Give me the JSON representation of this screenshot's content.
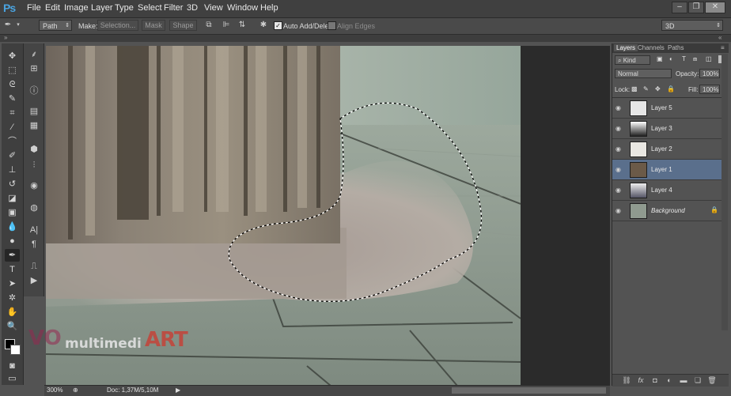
{
  "app": {
    "logo": "Ps"
  },
  "menubar": {
    "items": [
      "File",
      "Edit",
      "Image",
      "Layer",
      "Type",
      "Select",
      "Filter",
      "3D",
      "View",
      "Window",
      "Help"
    ]
  },
  "options_bar": {
    "mode_value": "Path",
    "make_label": "Make:",
    "selection_btn": "Selection...",
    "mask_btn": "Mask",
    "shape_btn": "Shape",
    "auto_add_delete": "Auto Add/Delete",
    "align_edges": "Align Edges",
    "workspace": "3D"
  },
  "status": {
    "zoom": "300%",
    "doc": "Doc: 1,37M/5,10M"
  },
  "layers_panel": {
    "tabs": [
      "Layers",
      "Channels",
      "Paths"
    ],
    "filter": "Kind",
    "blend_mode": "Normal",
    "opacity_label": "Opacity:",
    "opacity_value": "100%",
    "lock_label": "Lock:",
    "fill_label": "Fill:",
    "fill_value": "100%",
    "layers": [
      {
        "name": "Layer 5",
        "selected": false
      },
      {
        "name": "Layer 3",
        "selected": false
      },
      {
        "name": "Layer 2",
        "selected": false
      },
      {
        "name": "Layer 1",
        "selected": true
      },
      {
        "name": "Layer 4",
        "selected": false
      },
      {
        "name": "Background",
        "selected": false
      }
    ]
  },
  "watermark": {
    "part1": "VO",
    "part2": "multimedi",
    "part3": "ART"
  },
  "colors": {
    "selected_layer": "#5a6f8c",
    "accent": "#4aa3e0"
  }
}
